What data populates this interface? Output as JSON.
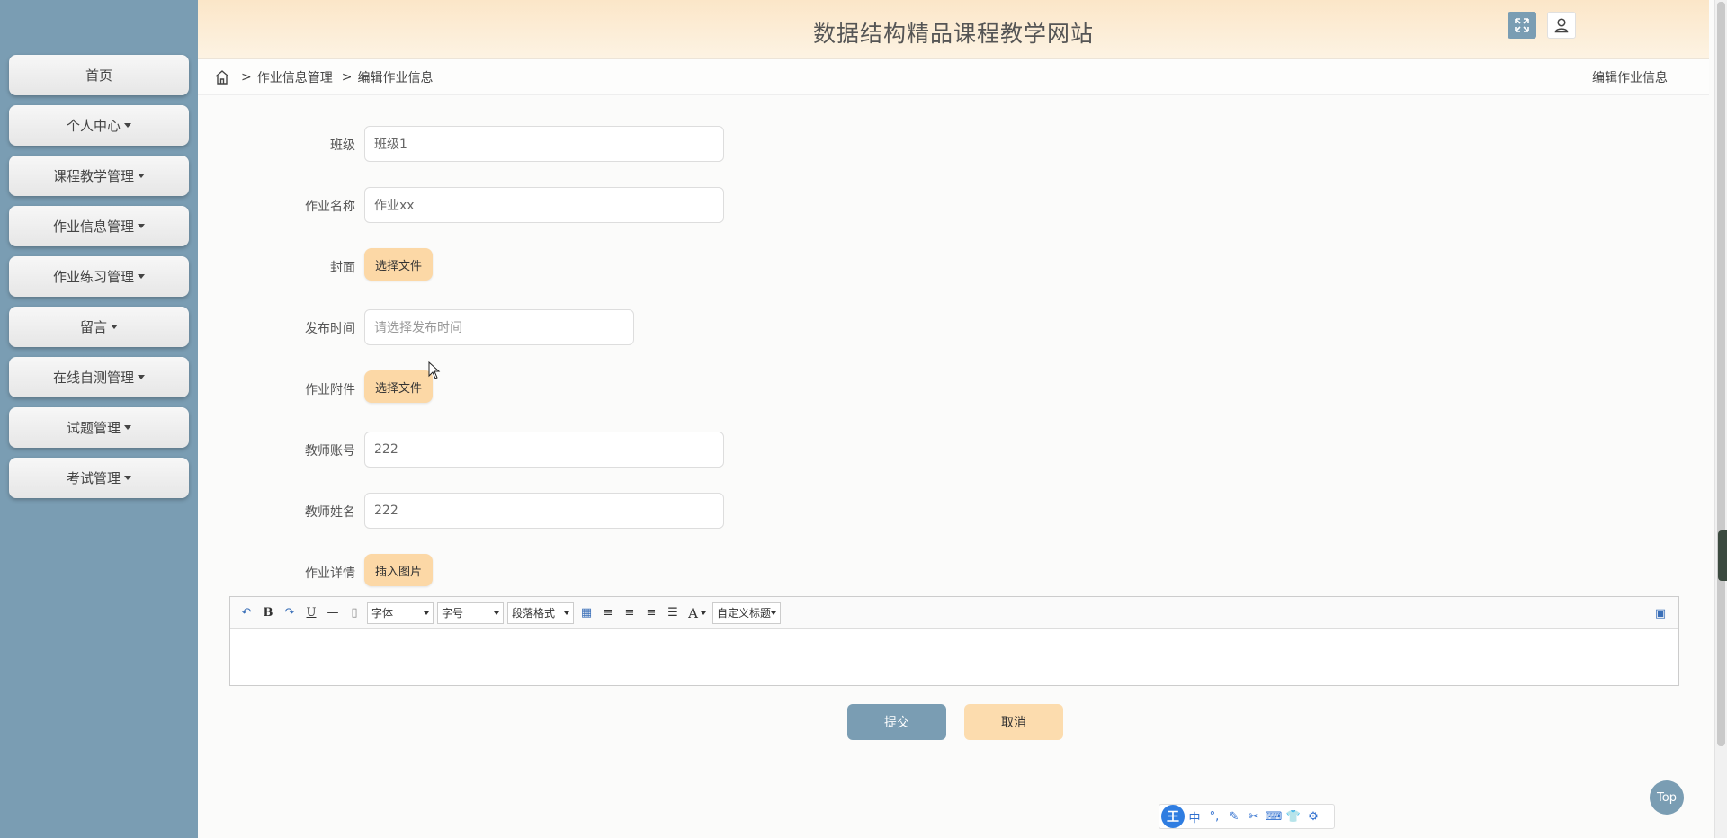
{
  "header": {
    "title": "数据结构精品课程教学网站",
    "expand_icon": "expand-icon",
    "user_icon": "user-icon"
  },
  "sidebar": {
    "items": [
      {
        "label": "首页",
        "dropdown": false
      },
      {
        "label": "个人中心",
        "dropdown": true
      },
      {
        "label": "课程教学管理",
        "dropdown": true
      },
      {
        "label": "作业信息管理",
        "dropdown": true
      },
      {
        "label": "作业练习管理",
        "dropdown": true
      },
      {
        "label": "留言",
        "dropdown": true
      },
      {
        "label": "在线自测管理",
        "dropdown": true
      },
      {
        "label": "试题管理",
        "dropdown": true
      },
      {
        "label": "考试管理",
        "dropdown": true
      }
    ]
  },
  "breadcrumb": {
    "sep": ">",
    "items": [
      "作业信息管理",
      "编辑作业信息"
    ],
    "right_title": "编辑作业信息"
  },
  "form": {
    "class_label": "班级",
    "class_value": "班级1",
    "name_label": "作业名称",
    "name_value": "作业xx",
    "cover_label": "封面",
    "cover_button": "选择文件",
    "publish_label": "发布时间",
    "publish_placeholder": "请选择发布时间",
    "attachment_label": "作业附件",
    "attachment_button": "选择文件",
    "teacher_account_label": "教师账号",
    "teacher_account_value": "222",
    "teacher_name_label": "教师姓名",
    "teacher_name_value": "222",
    "detail_label": "作业详情",
    "detail_button": "插入图片"
  },
  "editor": {
    "font_label": "字体",
    "size_label": "字号",
    "paragraph_label": "段落格式",
    "custom_title_label": "自定义标题",
    "bold": "B",
    "underline": "U",
    "font_color": "A"
  },
  "actions": {
    "submit": "提交",
    "cancel": "取消"
  },
  "top_button": "Top",
  "ime": {
    "logo": "王",
    "items": [
      "中",
      "°,",
      "✎",
      "✂",
      "⌨",
      "👕",
      "⚙"
    ]
  },
  "colors": {
    "sidebar": "#7a9db3",
    "accent_peach": "#fcd8a6",
    "header_gradient_top": "#fbe6c8"
  }
}
